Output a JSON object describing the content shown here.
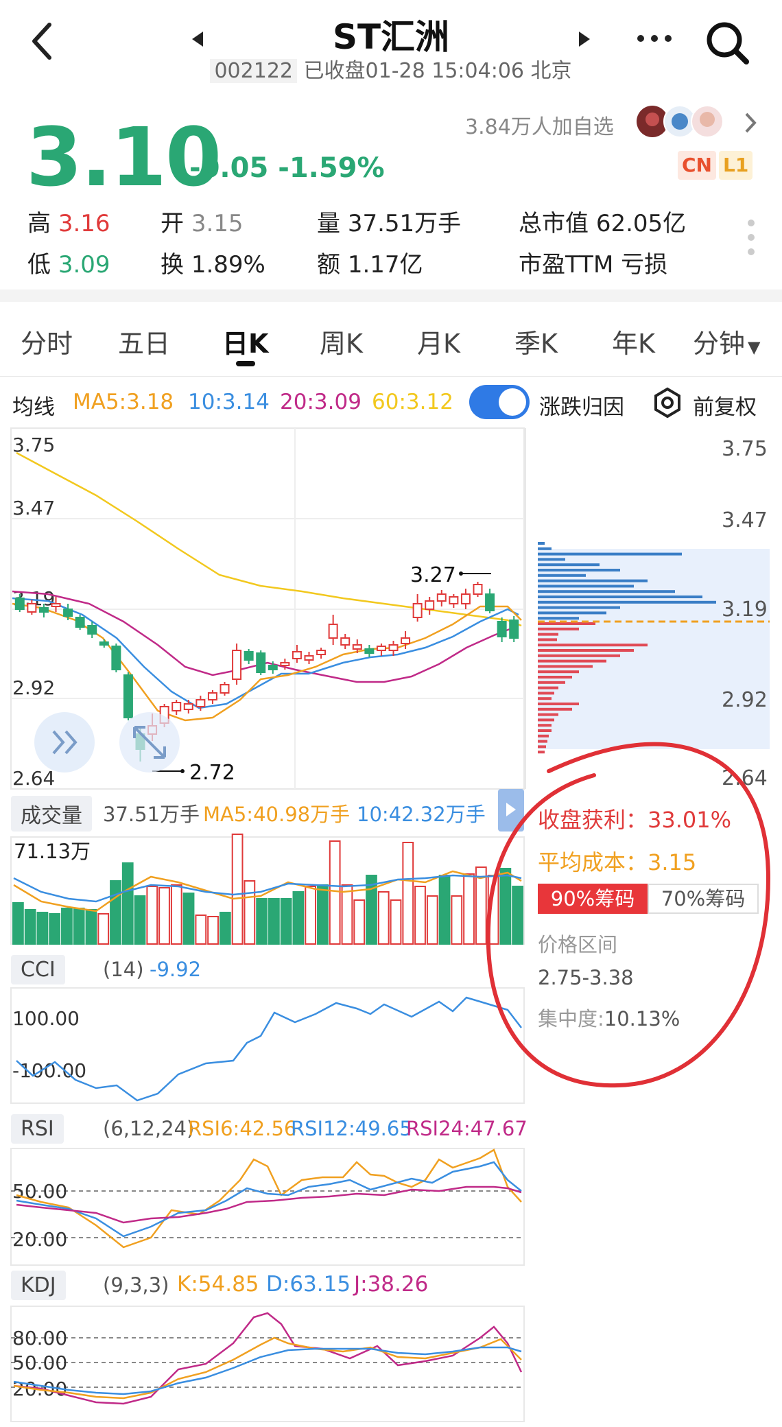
{
  "header": {
    "back_icon": "chevron-left-icon",
    "prev_icon": "triangle-left-icon",
    "next_icon": "triangle-right-icon",
    "more_icon": "more-dots-icon",
    "search_icon": "search-icon",
    "title": "ST汇洲",
    "code": "002122",
    "status": "已收盘01-28 15:04:06 北京"
  },
  "quote": {
    "price": "3.10",
    "change": "-0.05 -1.59%",
    "followers": "3.84万人加自选",
    "badge_cn": "CN",
    "badge_l1": "L1",
    "high_label": "高",
    "high": "3.16",
    "open_label": "开",
    "open": "3.15",
    "volume_label": "量",
    "volume": "37.51万手",
    "mktcap_label": "总市值",
    "mktcap": "62.05亿",
    "low_label": "低",
    "low": "3.09",
    "turnover_label": "换",
    "turnover": "1.89%",
    "amount_label": "额",
    "amount": "1.17亿",
    "pe_label": "市盈TTM",
    "pe": "亏损"
  },
  "tabs": [
    "分时",
    "五日",
    "日K",
    "周K",
    "月K",
    "季K",
    "年K",
    "分钟"
  ],
  "active_tab": "日K",
  "ma": {
    "label": "均线",
    "ma5": "MA5:3.18",
    "ma10": "10:3.14",
    "ma20": "20:3.09",
    "ma60": "60:3.12",
    "attrib": "涨跌归因",
    "adjust": "前复权"
  },
  "colors": {
    "up": "#e03a3a",
    "down": "#2aa774",
    "ma5": "#f0a020",
    "ma10": "#3a8ee0",
    "ma20": "#c02a88",
    "ma60": "#f2c81e",
    "accent": "#2f7ae5"
  },
  "kline": {
    "axis_left": [
      "3.75",
      "3.47",
      "3.19",
      "2.92",
      "2.64"
    ],
    "axis_right": [
      "3.75",
      "3.47",
      "3.19",
      "2.92",
      "2.64"
    ],
    "high_mark": "3.27",
    "low_mark": "2.72"
  },
  "volume": {
    "label": "成交量",
    "current": "37.51万手",
    "ma5": "MA5:40.98万手",
    "ma10": "10:42.32万手",
    "max": "71.13万"
  },
  "chip": {
    "profit_label": "收盘获利：",
    "profit": "33.01%",
    "cost_label": "平均成本：",
    "cost": "3.15",
    "tab90": "90%筹码",
    "tab70": "70%筹码",
    "range_label": "价格区间",
    "range": "2.75-3.38",
    "conc_label": "集中度:",
    "conc": "10.13%"
  },
  "cci": {
    "label": "CCI",
    "param": "(14)",
    "value": "-9.92",
    "axis": [
      "100.00",
      "-100.00"
    ]
  },
  "rsi": {
    "label": "RSI",
    "param": "(6,12,24)",
    "rsi6": "RSI6:42.56",
    "rsi12": "RSI12:49.65",
    "rsi24": "RSI24:47.67",
    "axis": [
      "50.00",
      "20.00"
    ]
  },
  "kdj": {
    "label": "KDJ",
    "param": "(9,3,3)",
    "k": "K:54.85",
    "d": "D:63.15",
    "j": "J:38.26",
    "axis": [
      "80.00",
      "50.00",
      "20.00"
    ]
  }
}
